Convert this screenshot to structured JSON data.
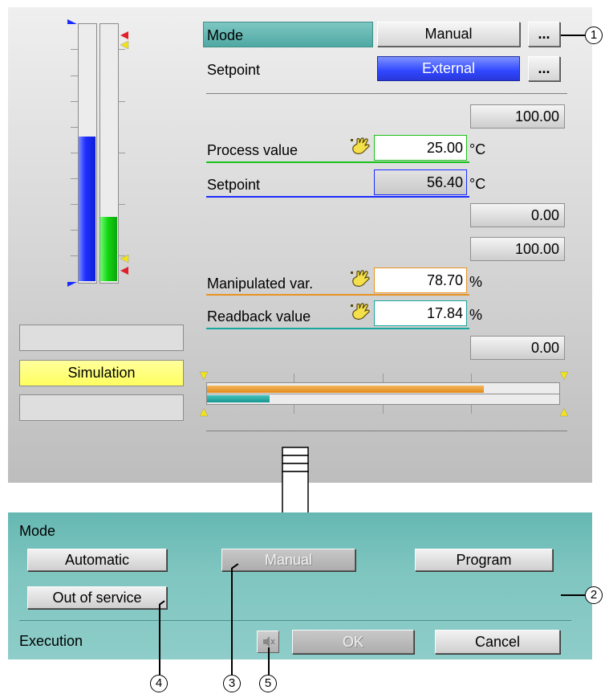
{
  "faceplate": {
    "mode": {
      "label": "Mode",
      "value": "Manual",
      "more_button": "..."
    },
    "setpoint_source": {
      "label": "Setpoint",
      "value": "External",
      "more_button": "..."
    },
    "pv_high_limit": "100.00",
    "process_value": {
      "label": "Process value",
      "value": "25.00",
      "unit": "°C"
    },
    "setpoint": {
      "label": "Setpoint",
      "value": "56.40",
      "unit": "°C"
    },
    "pv_low_limit": "0.00",
    "mv_high_limit": "100.00",
    "manipulated_var": {
      "label": "Manipulated var.",
      "value": "78.70",
      "unit": "%"
    },
    "readback_value": {
      "label": "Readback value",
      "value": "17.84",
      "unit": "%"
    },
    "mv_low_limit": "0.00",
    "status_slots": {
      "simulation": "Simulation"
    },
    "bars": {
      "blue_level": 0.564,
      "green_level": 0.25,
      "orange_level": 0.787,
      "teal_level": 0.178
    }
  },
  "mode_panel": {
    "title": "Mode",
    "automatic": "Automatic",
    "manual": "Manual",
    "program": "Program",
    "out_of_service": "Out of service",
    "execution": "Execution",
    "ok": "OK",
    "cancel": "Cancel"
  },
  "callouts": [
    "1",
    "2",
    "3",
    "4",
    "5"
  ],
  "colors": {
    "mode_header": "#57b0aa",
    "external_blue": "#3d57ff",
    "pv_green": "#19c219",
    "sp_blue": "#1a2cff",
    "mv_orange": "#e79224",
    "readback_teal": "#1aa6a0",
    "simulation_yellow": "#ffff80"
  }
}
